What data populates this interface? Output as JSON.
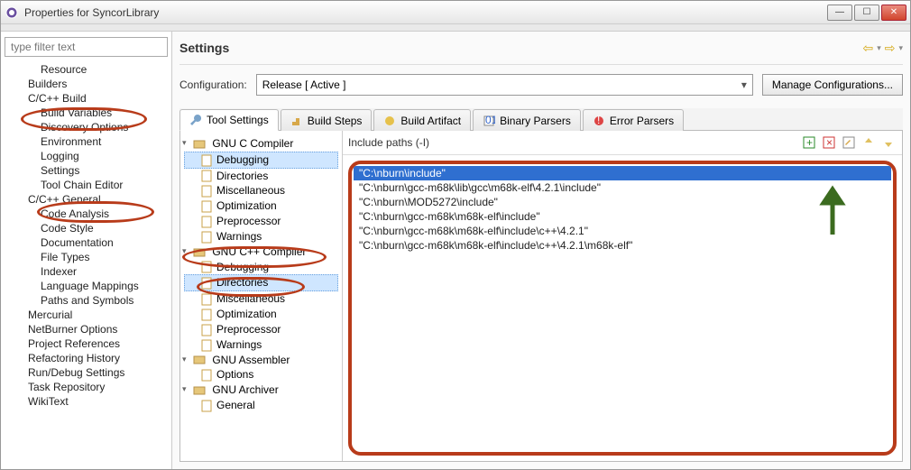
{
  "window": {
    "title": "Properties for SyncorLibrary"
  },
  "sidebar": {
    "filter_placeholder": "type filter text",
    "items": [
      "Resource",
      "Builders",
      "C/C++ Build",
      "Build Variables",
      "Discovery Options",
      "Environment",
      "Logging",
      "Settings",
      "Tool Chain Editor",
      "C/C++ General",
      "Code Analysis",
      "Code Style",
      "Documentation",
      "File Types",
      "Indexer",
      "Language Mappings",
      "Paths and Symbols",
      "Mercurial",
      "NetBurner Options",
      "Project References",
      "Refactoring History",
      "Run/Debug Settings",
      "Task Repository",
      "WikiText"
    ]
  },
  "page_title": "Settings",
  "config": {
    "label": "Configuration:",
    "value": "Release  [ Active ]",
    "manage": "Manage Configurations..."
  },
  "tabs": {
    "tool_settings": "Tool Settings",
    "build_steps": "Build Steps",
    "build_artifact": "Build Artifact",
    "binary_parsers": "Binary Parsers",
    "error_parsers": "Error Parsers"
  },
  "tool_tree": {
    "g1": "GNU C Compiler",
    "g1_items": [
      "Debugging",
      "Directories",
      "Miscellaneous",
      "Optimization",
      "Preprocessor",
      "Warnings"
    ],
    "g2": "GNU C++ Compiler",
    "g2_items": [
      "Debugging",
      "Directories",
      "Miscellaneous",
      "Optimization",
      "Preprocessor",
      "Warnings"
    ],
    "g3": "GNU Assembler",
    "g3_items": [
      "Options"
    ],
    "g4": "GNU Archiver",
    "g4_items": [
      "General"
    ]
  },
  "include": {
    "label": "Include paths (-I)",
    "paths": [
      "\"C:\\nburn\\include\"",
      "\"C:\\nburn\\gcc-m68k\\lib\\gcc\\m68k-elf\\4.2.1\\include\"",
      "\"C:\\nburn\\MOD5272\\include\"",
      "\"C:\\nburn\\gcc-m68k\\m68k-elf\\include\"",
      "\"C:\\nburn\\gcc-m68k\\m68k-elf\\include\\c++\\4.2.1\"",
      "\"C:\\nburn\\gcc-m68k\\m68k-elf\\include\\c++\\4.2.1\\m68k-elf\""
    ]
  }
}
